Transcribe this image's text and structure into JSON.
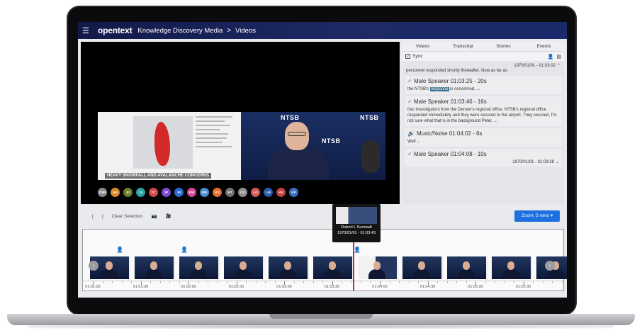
{
  "topbar": {
    "menu_icon": "hamburger-icon",
    "brand": "opentext",
    "app_name": "Knowledge Discovery Media",
    "separator": ">",
    "crumb": "Videos"
  },
  "video": {
    "slide_caption": "HEAVY SNOWFALL AND AVALANCHE CONCERNS",
    "ntsb_labels": [
      "NTSB",
      "NTSB",
      "NTSB"
    ],
    "participants": [
      {
        "initials": "CNN",
        "color": "#8a8a8a"
      },
      {
        "initials": "AA",
        "color": "#d98a2a"
      },
      {
        "initials": "JD",
        "color": "#6a7d2a"
      },
      {
        "initials": "JS",
        "color": "#2aa0a0"
      },
      {
        "initials": "TC",
        "color": "#d04848"
      },
      {
        "initials": "JP",
        "color": "#7a4ad0"
      },
      {
        "initials": "JR",
        "color": "#2a6ad0"
      },
      {
        "initials": "KW",
        "color": "#d04890"
      },
      {
        "initials": "MD",
        "color": "#4a8ad0"
      },
      {
        "initials": "KS",
        "color": "#e07030"
      },
      {
        "initials": "MT",
        "color": "#707070"
      },
      {
        "initials": "CG",
        "color": "#909090"
      },
      {
        "initials": "LG",
        "color": "#d05a5a"
      },
      {
        "initials": "LM",
        "color": "#2a5ab0"
      },
      {
        "initials": "KK",
        "color": "#c04040"
      },
      {
        "initials": "KP",
        "color": "#3a70c0"
      }
    ]
  },
  "panel": {
    "tabs": [
      "Videos",
      "Transcript",
      "Stories",
      "Events"
    ],
    "sync_label": "Sync",
    "sync_icons": [
      "person-icon",
      "caption-icon"
    ],
    "top_timestamp": "1970/01/01 - 01:03:02",
    "first_text": "personnel responded shortly thereafter. Now as far as",
    "segments": [
      {
        "icon": "male-icon",
        "speaker": "Male Speaker 01:03:25 - 20s",
        "text_before": "the NTSB's ",
        "highlight": "response",
        "text_after": " is concerned, ..."
      },
      {
        "icon": "male-icon",
        "speaker": "Male Speaker 01:03:46 - 16s",
        "text_before": "four investigators from the Denver's regional office, NTSB's regional office responded immediately and they were secured to the airport. They secured, I'm not sure what that is in the background Peter. ...",
        "highlight": "",
        "text_after": ""
      },
      {
        "icon": "speaker-icon",
        "speaker": "Music/Noise 01:04:02 - 6s",
        "text_before": "Well ...",
        "highlight": "",
        "text_after": ""
      },
      {
        "icon": "male-icon",
        "speaker": "Male Speaker 01:04:08 - 10s",
        "text_before": "",
        "highlight": "",
        "text_after": ""
      }
    ],
    "bottom_timestamp": "1970/01/01 - 01:03:38"
  },
  "controls": {
    "bracket_open": "[",
    "bracket_close": "]",
    "clear_selection": "Clear Selection",
    "zoom_label": "Zoom: 5 mins"
  },
  "tooltip": {
    "name": "Robert L Sumwalt",
    "time": "1970/01/01 - 01:03:43"
  },
  "timeline": {
    "ticks": [
      "01:01:00",
      "01:01:30",
      "01:02:00",
      "01:02:30",
      "01:03:00",
      "01:03:30",
      "01:04:00",
      "01:04:30",
      "01:05:00",
      "01:05:30"
    ],
    "thumb_count": 11,
    "accent": "#d6187a"
  }
}
